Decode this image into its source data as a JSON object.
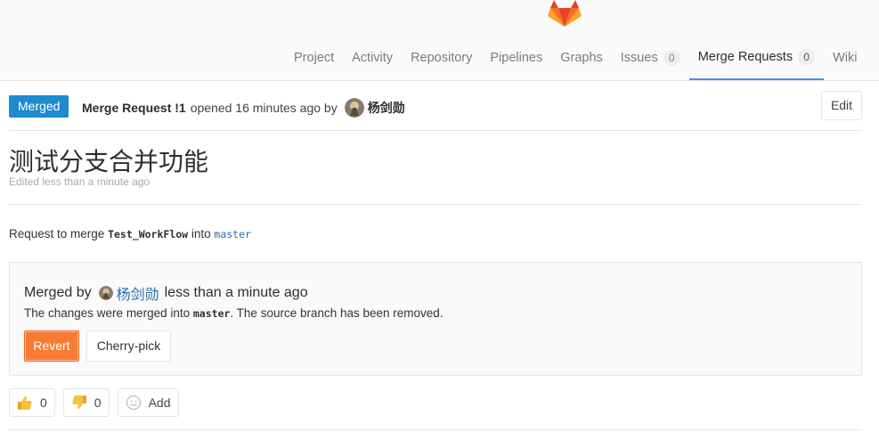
{
  "nav": {
    "items": [
      {
        "label": "Project"
      },
      {
        "label": "Activity"
      },
      {
        "label": "Repository"
      },
      {
        "label": "Pipelines"
      },
      {
        "label": "Graphs"
      },
      {
        "label": "Issues",
        "count": "0"
      },
      {
        "label": "Merge Requests",
        "count": "0",
        "active": true
      },
      {
        "label": "Wiki"
      }
    ]
  },
  "mr": {
    "status": "Merged",
    "ref": "Merge Request !1",
    "opened_text": "opened 16 minutes ago by",
    "author": "杨剑勋",
    "edit_label": "Edit",
    "title": "测试分支合并功能",
    "edited": "Edited less than a minute ago",
    "request_prefix": "Request to merge",
    "source_branch": "Test_WorkFlow",
    "request_into": "into",
    "target_branch": "master"
  },
  "merged_panel": {
    "merged_by_label": "Merged by",
    "merged_by_user": "杨剑勋",
    "merged_time": "less than a minute ago",
    "note_prefix": "The changes were merged into",
    "note_branch": "master",
    "note_suffix": ". The source branch has been removed.",
    "revert_label": "Revert",
    "cherry_pick_label": "Cherry-pick"
  },
  "awards": {
    "thumbsup_count": "0",
    "thumbsdown_count": "0",
    "add_label": "Add"
  },
  "colors": {
    "merged_badge": "#1f8ace",
    "revert_button": "#f77b32",
    "active_tab_underline": "#4a8bee",
    "link": "#2b6eab"
  }
}
